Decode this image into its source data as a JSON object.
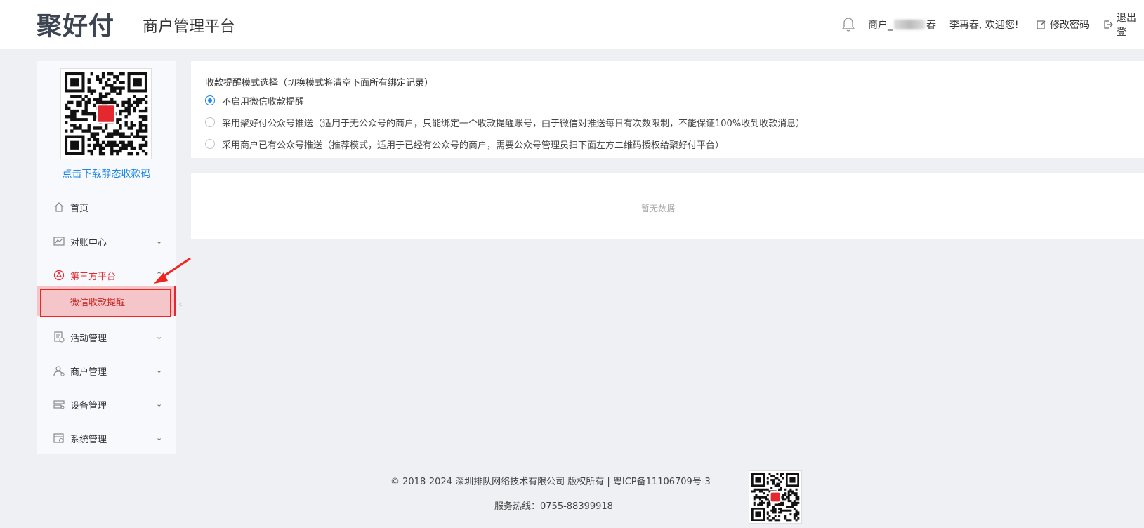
{
  "header": {
    "logo_text": "聚好付",
    "platform_name": "商户管理平台",
    "merchant_prefix": "商户_",
    "merchant_suffix": "春",
    "welcome": "李再春, 欢迎您!",
    "change_password": "修改密码",
    "logout": "退出登"
  },
  "sidebar": {
    "qr_label": "点击下载静态收款码",
    "items": [
      {
        "label": "首页",
        "icon": "home-icon"
      },
      {
        "label": "对账中心",
        "icon": "chart-icon"
      },
      {
        "label": "第三方平台",
        "icon": "platform-icon"
      },
      {
        "label": "活动管理",
        "icon": "activity-icon"
      },
      {
        "label": "商户管理",
        "icon": "user-icon"
      },
      {
        "label": "设备管理",
        "icon": "device-icon"
      },
      {
        "label": "系统管理",
        "icon": "settings-icon"
      }
    ],
    "submenu_selected": "微信收款提醒"
  },
  "main": {
    "mode_title": "收款提醒模式选择（切换模式将清空下面所有绑定记录）",
    "options": [
      "不启用微信收款提醒",
      "采用聚好付公众号推送（适用于无公众号的商户，只能绑定一个收款提醒账号，由于微信对推送每日有次数限制，不能保证100%收到收款消息）",
      "采用商户已有公众号推送（推荐模式，适用于已经有公众号的商户，需要公众号管理员扫下面左方二维码授权给聚好付平台）"
    ],
    "selected_option": 0,
    "empty_text": "暂无数据"
  },
  "footer": {
    "copyright": "© 2018-2024 深圳排队网络技术有限公司 版权所有 | 粤ICP备11106709号-3",
    "hotline": "服务热线：0755-88399918"
  },
  "colors": {
    "brand_red": "#e5282f",
    "link_blue": "#1e88e5",
    "active_bg": "#f5c6c9"
  }
}
